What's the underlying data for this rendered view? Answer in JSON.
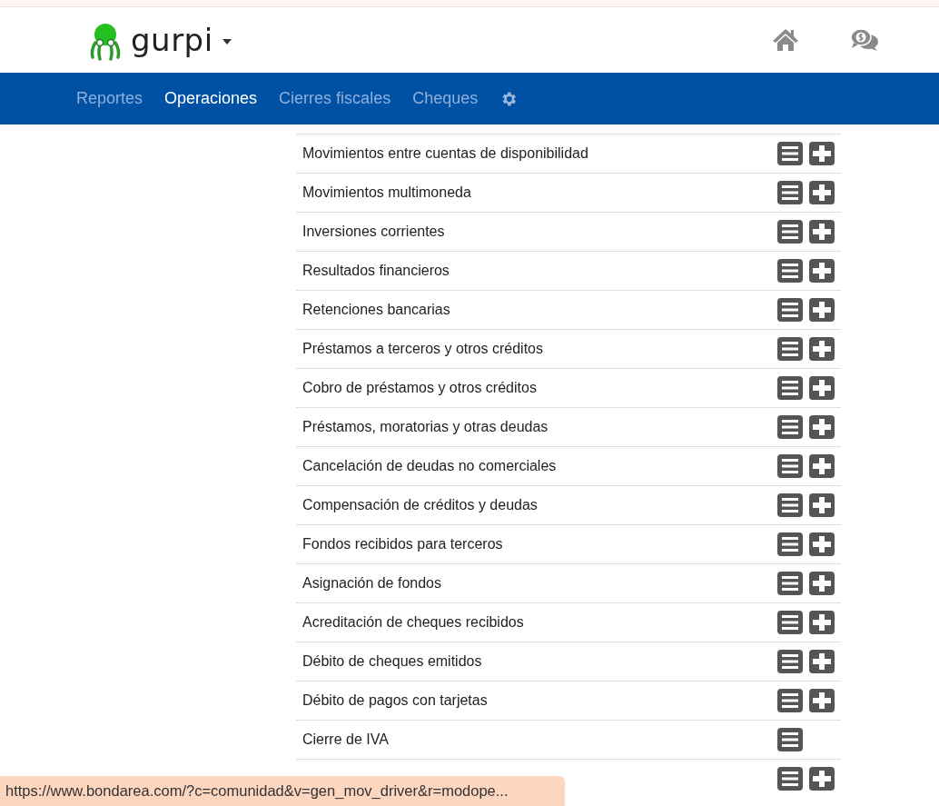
{
  "header": {
    "brand": "gurpi"
  },
  "nav": {
    "items": [
      {
        "label": "Reportes",
        "selected": false
      },
      {
        "label": "Operaciones",
        "selected": true
      },
      {
        "label": "Cierres fiscales",
        "selected": false
      },
      {
        "label": "Cheques",
        "selected": false
      }
    ]
  },
  "operations": [
    {
      "label": "Movimientos entre cuentas de disponibilidad",
      "can_add": true
    },
    {
      "label": "Movimientos multimoneda",
      "can_add": true
    },
    {
      "label": "Inversiones corrientes",
      "can_add": true
    },
    {
      "label": "Resultados financieros",
      "can_add": true
    },
    {
      "label": "Retenciones bancarias",
      "can_add": true
    },
    {
      "label": "Préstamos a terceros y otros créditos",
      "can_add": true
    },
    {
      "label": "Cobro de préstamos y otros créditos",
      "can_add": true
    },
    {
      "label": "Préstamos, moratorias y otras deudas",
      "can_add": true
    },
    {
      "label": "Cancelación de deudas no comerciales",
      "can_add": true
    },
    {
      "label": "Compensación de créditos y deudas",
      "can_add": true
    },
    {
      "label": "Fondos recibidos para terceros",
      "can_add": true
    },
    {
      "label": "Asignación de fondos",
      "can_add": true
    },
    {
      "label": "Acreditación de cheques recibidos",
      "can_add": true
    },
    {
      "label": "Débito de cheques emitidos",
      "can_add": true
    },
    {
      "label": "Débito de pagos con tarjetas",
      "can_add": true
    },
    {
      "label": "Cierre de IVA",
      "can_add": false
    },
    {
      "can_add": true
    }
  ],
  "status_bar": {
    "url": "https://www.bondarea.com/?c=comunidad&v=gen_mov_driver&r=modope..."
  }
}
